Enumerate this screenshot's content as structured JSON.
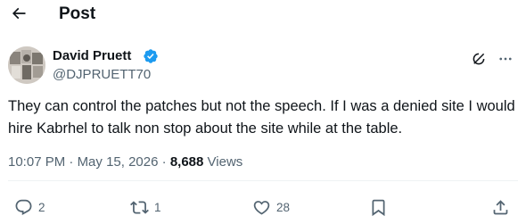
{
  "header": {
    "title": "Post",
    "back_icon": "arrow-left-icon"
  },
  "author": {
    "name": "David Pruett",
    "handle": "@DJPRUETT70",
    "verified_icon": "verified-badge-icon",
    "verified_color": "#1d9bf0"
  },
  "post": {
    "text": "They can control the patches but not the speech. If I was a denied site I would hire Kabrhel to talk non stop about the site while at the table.",
    "time": "10:07 PM",
    "separator1": "·",
    "date": "May 15, 2026",
    "separator2": "·",
    "views_count": "8,688",
    "views_label": "Views"
  },
  "actions": {
    "replies": "2",
    "reposts": "1",
    "likes": "28"
  },
  "colors": {
    "text": "#0f1419",
    "muted": "#536471",
    "divider": "#eff3f4"
  }
}
